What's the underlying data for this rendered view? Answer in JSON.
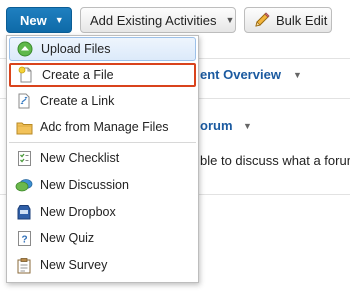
{
  "toolbar": {
    "new_label": "New",
    "add_existing_label": "Add Existing Activities",
    "bulk_edit_label": "Bulk Edit"
  },
  "background": {
    "heading1": "ent Overview",
    "heading2": "orum",
    "text1": "ble to discuss what a forum"
  },
  "menu": {
    "items": [
      {
        "label": "Upload Files",
        "icon": "upload-icon"
      },
      {
        "label": "Create a File",
        "icon": "new-file-icon"
      },
      {
        "label": "Create a Link",
        "icon": "link-icon"
      },
      {
        "label": "Adc from Manage Files",
        "icon": "folder-icon"
      },
      {
        "label": "New Checklist",
        "icon": "checklist-icon"
      },
      {
        "label": "New Discussion",
        "icon": "discussion-icon"
      },
      {
        "label": "New Dropbox",
        "icon": "dropbox-icon"
      },
      {
        "label": "New Quiz",
        "icon": "quiz-icon"
      },
      {
        "label": "New Survey",
        "icon": "survey-icon"
      }
    ]
  },
  "colors": {
    "primary": "#1176b8",
    "highlight_border": "#d9431c",
    "heading": "#1b5aa0"
  }
}
